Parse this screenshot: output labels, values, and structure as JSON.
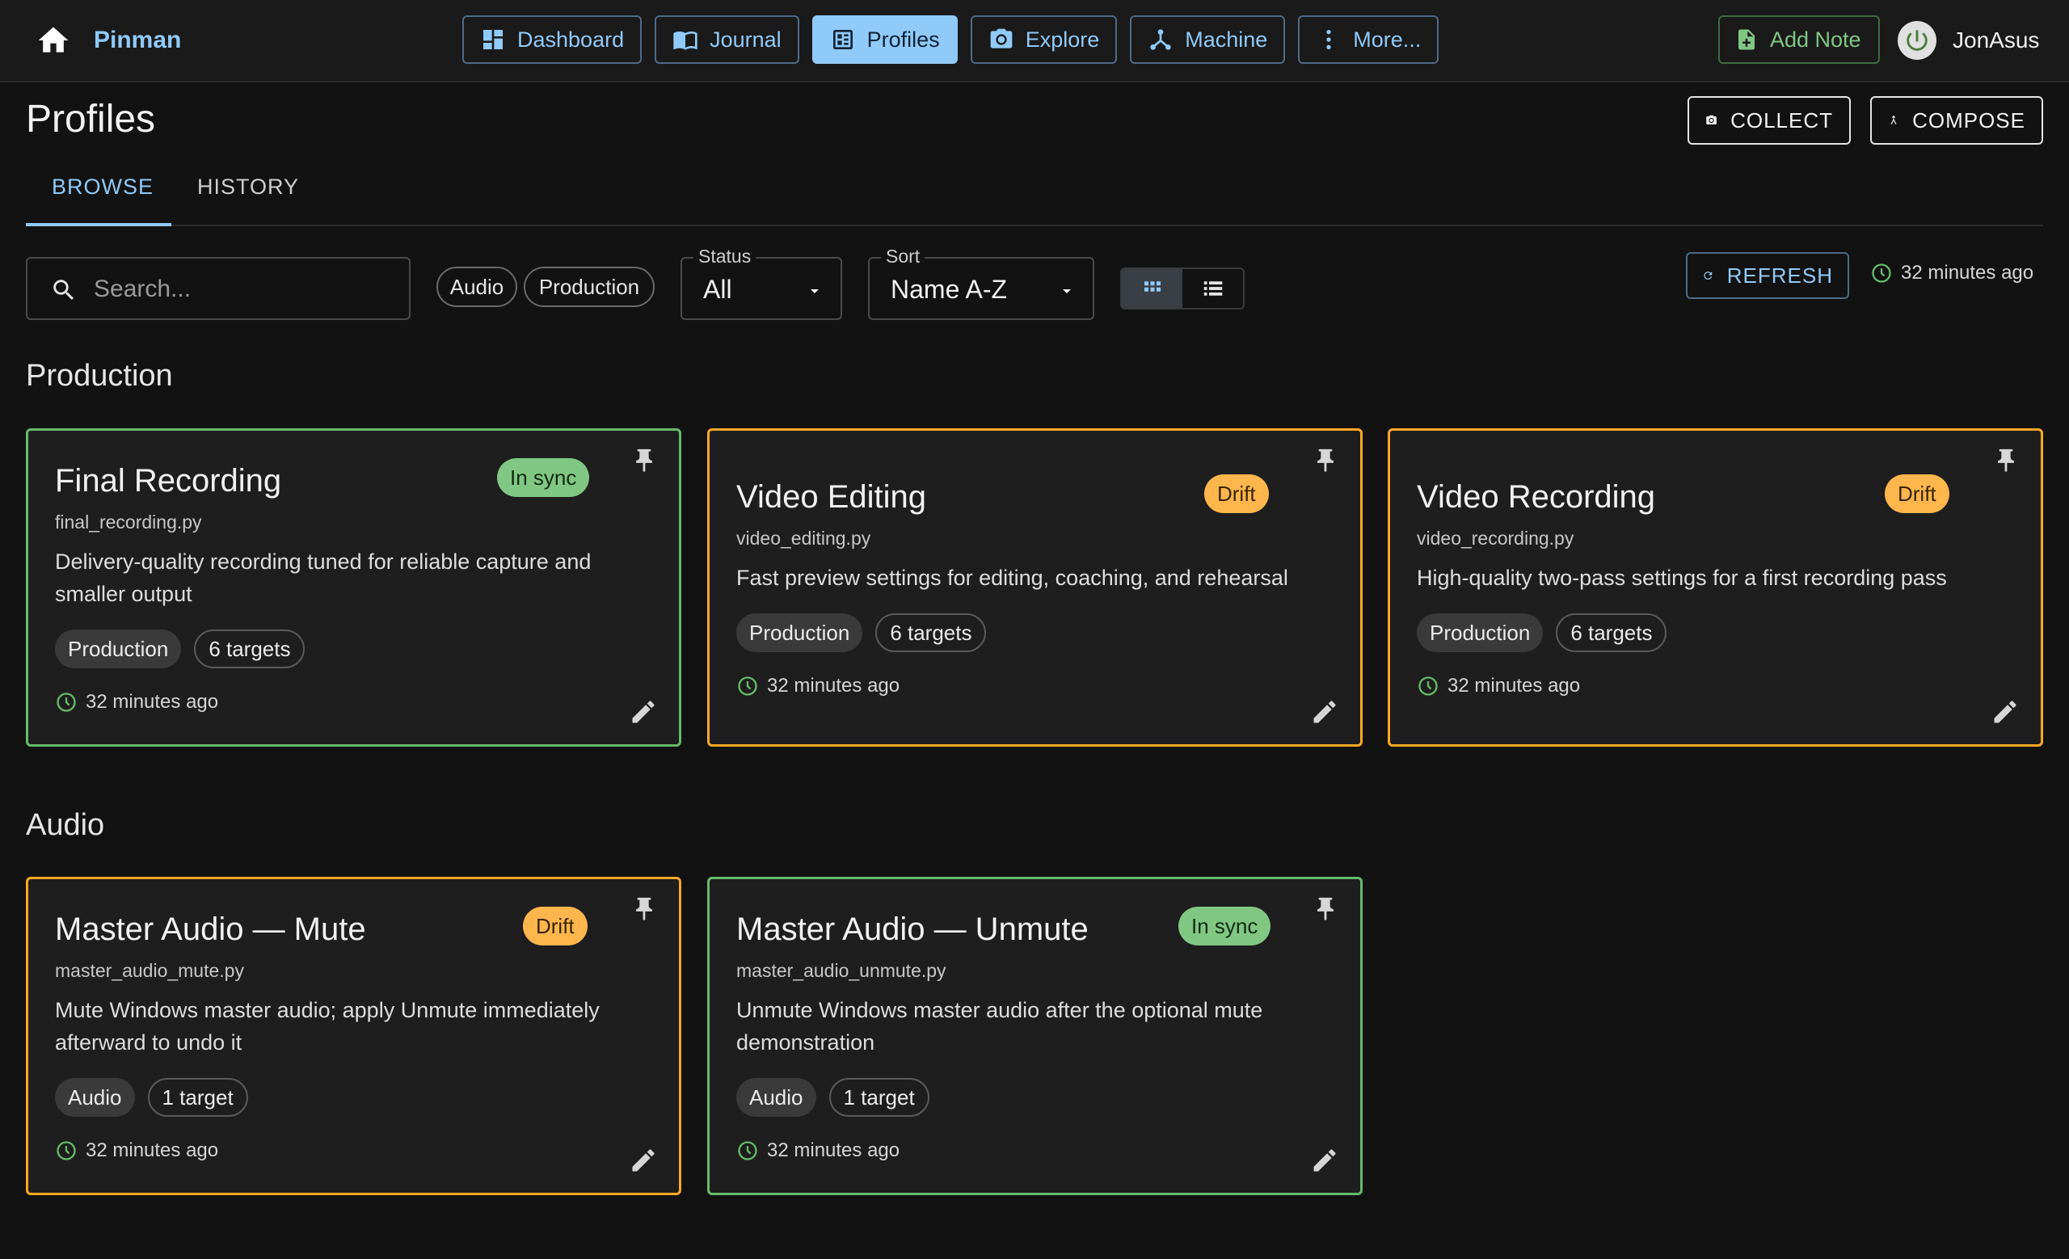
{
  "app": {
    "brand": "Pinman",
    "user": "JonAsus"
  },
  "nav": {
    "items": [
      {
        "label": "Dashboard",
        "icon": "dashboard-icon"
      },
      {
        "label": "Journal",
        "icon": "book-icon"
      },
      {
        "label": "Profiles",
        "icon": "profiles-icon",
        "active": true
      },
      {
        "label": "Explore",
        "icon": "camera-icon"
      },
      {
        "label": "Machine",
        "icon": "hub-icon"
      },
      {
        "label": "More...",
        "icon": "more-vertical-icon"
      }
    ],
    "add_note": "Add Note"
  },
  "page": {
    "title": "Profiles",
    "collect_label": "COLLECT",
    "compose_label": "COMPOSE",
    "tabs": [
      {
        "label": "BROWSE",
        "active": true
      },
      {
        "label": "HISTORY"
      }
    ]
  },
  "filters": {
    "search_placeholder": "Search...",
    "chips": [
      "Audio",
      "Production"
    ],
    "status_label": "Status",
    "status_value": "All",
    "sort_label": "Sort",
    "sort_value": "Name A-Z",
    "view": "grid",
    "refresh_label": "REFRESH",
    "updated": "32 minutes ago"
  },
  "sections": [
    {
      "title": "Production",
      "cards": [
        {
          "title": "Final Recording",
          "file": "final_recording.py",
          "description": "Delivery-quality recording tuned for reliable capture and smaller output",
          "status": "In sync",
          "tag": "Production",
          "targets": "6 targets",
          "time": "32 minutes ago"
        },
        {
          "title": "Video Editing",
          "file": "video_editing.py",
          "description": "Fast preview settings for editing, coaching, and rehearsal",
          "status": "Drift",
          "tag": "Production",
          "targets": "6 targets",
          "time": "32 minutes ago"
        },
        {
          "title": "Video Recording",
          "file": "video_recording.py",
          "description": "High-quality two-pass settings for a first recording pass",
          "status": "Drift",
          "tag": "Production",
          "targets": "6 targets",
          "time": "32 minutes ago"
        }
      ]
    },
    {
      "title": "Audio",
      "cards": [
        {
          "title": "Master Audio — Mute",
          "file": "master_audio_mute.py",
          "description": "Mute Windows master audio; apply Unmute immediately afterward to undo it",
          "status": "Drift",
          "tag": "Audio",
          "targets": "1 target",
          "time": "32 minutes ago"
        },
        {
          "title": "Master Audio — Unmute",
          "file": "master_audio_unmute.py",
          "description": "Unmute Windows master audio after the optional mute demonstration",
          "status": "In sync",
          "tag": "Audio",
          "targets": "1 target",
          "time": "32 minutes ago"
        }
      ]
    }
  ],
  "colors": {
    "accent": "#90caf9",
    "in_sync": "#66bb6a",
    "drift": "#ffa726",
    "background": "#121212"
  }
}
